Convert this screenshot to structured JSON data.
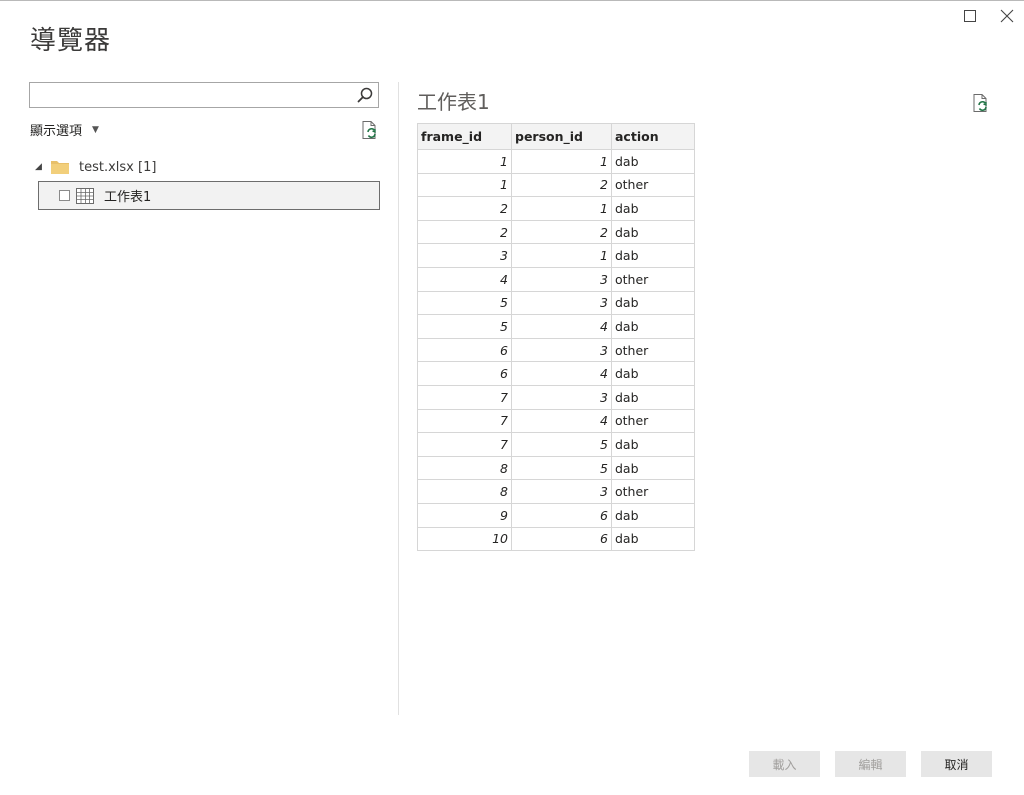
{
  "window": {
    "title": "導覽器",
    "maximize_icon": "maximize-icon",
    "close_icon": "close-icon"
  },
  "left_panel": {
    "search": {
      "value": "",
      "placeholder": ""
    },
    "display_options": {
      "label": "顯示選項"
    },
    "tree": {
      "folder": {
        "label": "test.xlsx [1]"
      },
      "items": [
        {
          "label": "工作表1",
          "checked": false,
          "selected": true
        }
      ]
    }
  },
  "preview": {
    "title": "工作表1",
    "columns": [
      "frame_id",
      "person_id",
      "action"
    ],
    "rows": [
      [
        "1",
        "1",
        "dab"
      ],
      [
        "1",
        "2",
        "other"
      ],
      [
        "2",
        "1",
        "dab"
      ],
      [
        "2",
        "2",
        "dab"
      ],
      [
        "3",
        "1",
        "dab"
      ],
      [
        "4",
        "3",
        "other"
      ],
      [
        "5",
        "3",
        "dab"
      ],
      [
        "5",
        "4",
        "dab"
      ],
      [
        "6",
        "3",
        "other"
      ],
      [
        "6",
        "4",
        "dab"
      ],
      [
        "7",
        "3",
        "dab"
      ],
      [
        "7",
        "4",
        "other"
      ],
      [
        "7",
        "5",
        "dab"
      ],
      [
        "8",
        "5",
        "dab"
      ],
      [
        "8",
        "3",
        "other"
      ],
      [
        "9",
        "6",
        "dab"
      ],
      [
        "10",
        "6",
        "dab"
      ]
    ]
  },
  "footer": {
    "load_label": "載入",
    "edit_label": "編輯",
    "cancel_label": "取消"
  },
  "colors": {
    "accent": "#217346",
    "folder": "#e8c06a",
    "button_bg": "#e6e6e6",
    "disabled_text": "#a19f9d"
  }
}
